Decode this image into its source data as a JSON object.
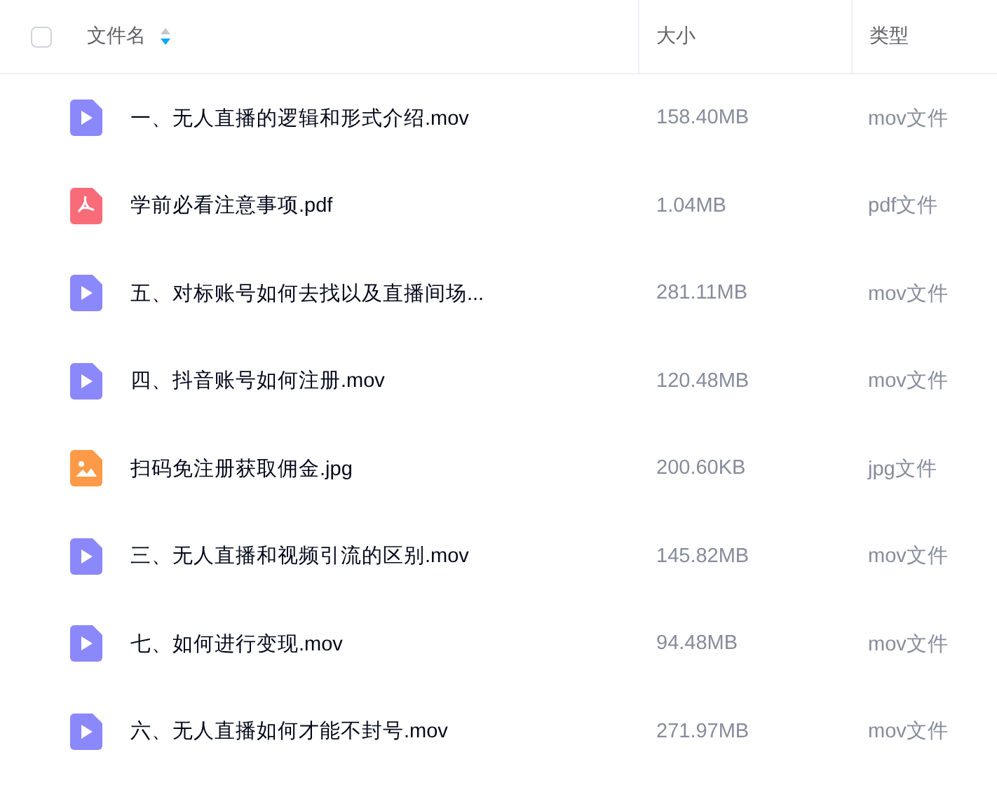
{
  "header": {
    "select_all": {
      "checked": false
    },
    "columns": [
      {
        "label": "文件名",
        "sort_descending": true
      },
      {
        "label": "大小"
      },
      {
        "label": "类型"
      }
    ]
  },
  "files": [
    {
      "kind": "video",
      "name": "一、无人直播的逻辑和形式介绍.mov",
      "size": "158.40MB",
      "type": "mov文件"
    },
    {
      "kind": "pdf",
      "name": "学前必看注意事项.pdf",
      "size": "1.04MB",
      "type": "pdf文件"
    },
    {
      "kind": "video",
      "name": "五、对标账号如何去找以及直播间场...",
      "size": "281.11MB",
      "type": "mov文件"
    },
    {
      "kind": "video",
      "name": "四、抖音账号如何注册.mov",
      "size": "120.48MB",
      "type": "mov文件"
    },
    {
      "kind": "image",
      "name": "扫码免注册获取佣金.jpg",
      "size": "200.60KB",
      "type": "jpg文件"
    },
    {
      "kind": "video",
      "name": "三、无人直播和视频引流的区别.mov",
      "size": "145.82MB",
      "type": "mov文件"
    },
    {
      "kind": "video",
      "name": "七、如何进行变现.mov",
      "size": "94.48MB",
      "type": "mov文件"
    },
    {
      "kind": "video",
      "name": "六、无人直播如何才能不封号.mov",
      "size": "271.97MB",
      "type": "mov文件"
    }
  ]
}
